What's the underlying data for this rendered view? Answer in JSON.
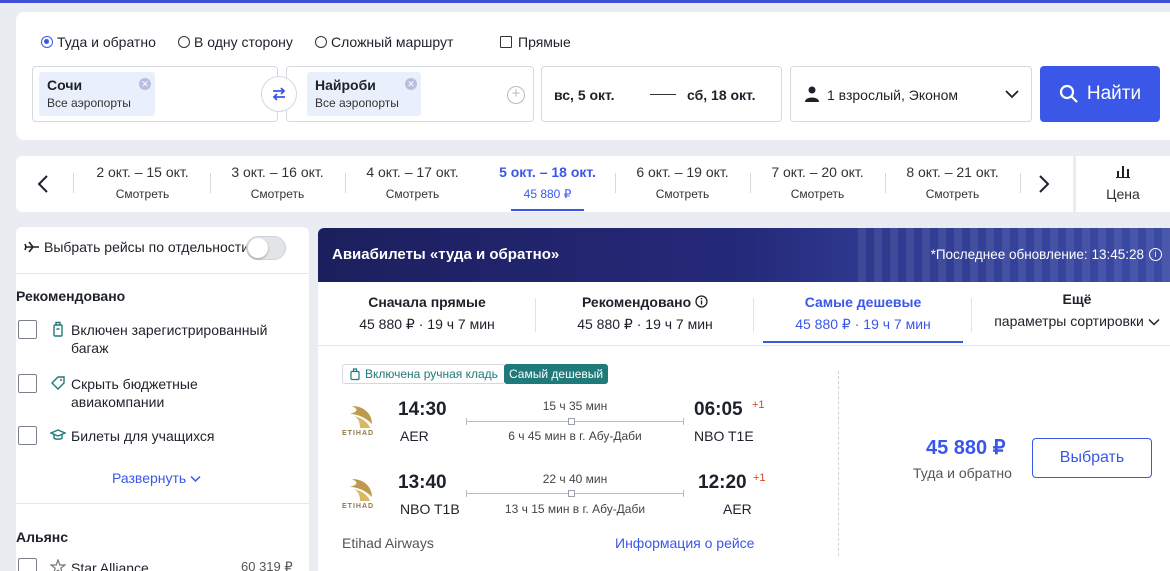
{
  "trip_types": {
    "round": "Туда и обратно",
    "oneway": "В одну сторону",
    "complex": "Сложный маршрут",
    "direct": "Прямые"
  },
  "search": {
    "from_city": "Сочи",
    "from_sub": "Все аэропорты",
    "to_city": "Найроби",
    "to_sub": "Все аэропорты",
    "date_from": "вс, 5 окт.",
    "date_to": "сб, 18 окт.",
    "passengers": "1 взрослый, Эконом",
    "search_button": "Найти"
  },
  "date_strip": {
    "cells": [
      {
        "range": "2 окт. – 15 окт.",
        "sub": "Смотреть"
      },
      {
        "range": "3 окт. – 16 окт.",
        "sub": "Смотреть"
      },
      {
        "range": "4 окт. – 17 окт.",
        "sub": "Смотреть"
      },
      {
        "range": "5 окт. – 18 окт.",
        "sub": "45 880 ₽"
      },
      {
        "range": "6 окт. – 19 окт.",
        "sub": "Смотреть"
      },
      {
        "range": "7 окт. – 20 окт.",
        "sub": "Смотреть"
      },
      {
        "range": "8 окт. – 21 окт.",
        "sub": "Смотреть"
      }
    ],
    "price_tab": "Цена"
  },
  "sidebar": {
    "toggle_label": "Выбрать рейсы по отдельности",
    "recommended_title": "Рекомендовано",
    "options": [
      {
        "line1": "Включен зарегистрированный",
        "line2": "багаж"
      },
      {
        "line1": "Скрыть бюджетные",
        "line2": "авиакомпании"
      },
      {
        "line1": "Билеты для учащихся",
        "line2": ""
      }
    ],
    "expand": "Развернуть",
    "alliance_title": "Альянс",
    "alliance_item": "Star Alliance",
    "alliance_price": "60 319 ₽"
  },
  "results": {
    "title": "Авиабилеты «туда и обратно»",
    "update": "*Последнее обновление: 13:45:28",
    "sort_tabs": [
      {
        "title": "Сначала прямые",
        "sub": "45 880 ₽ · 19 ч 7 мин"
      },
      {
        "title": "Рекомендовано",
        "sub": "45 880 ₽ · 19 ч 7 мин"
      },
      {
        "title": "Самые дешевые",
        "sub": "45 880 ₽ · 19 ч 7 мин"
      },
      {
        "title": "Ещё",
        "sub": "параметры сортировки"
      }
    ],
    "badge_bag": "Включена ручная кладь",
    "badge_cheap": "Самый дешевый",
    "logo_text": "ETIHAD",
    "legs": [
      {
        "dep_time": "14:30",
        "dep_airport": "AER",
        "duration": "15 ч 35 мин",
        "layover": "6 ч 45 мин в г. Абу-Даби",
        "arr_time": "06:05",
        "plus": "+1",
        "arr_airport": "NBO T1E"
      },
      {
        "dep_time": "13:40",
        "dep_airport": "NBO T1B",
        "duration": "22 ч 40 мин",
        "layover": "13 ч 15 мин в г. Абу-Даби",
        "arr_time": "12:20",
        "plus": "+1",
        "arr_airport": "AER"
      }
    ],
    "airline": "Etihad Airways",
    "info_link": "Информация о рейсе",
    "price": "45 880 ₽",
    "price_sub": "Туда и обратно",
    "choose_button": "Выбрать"
  }
}
